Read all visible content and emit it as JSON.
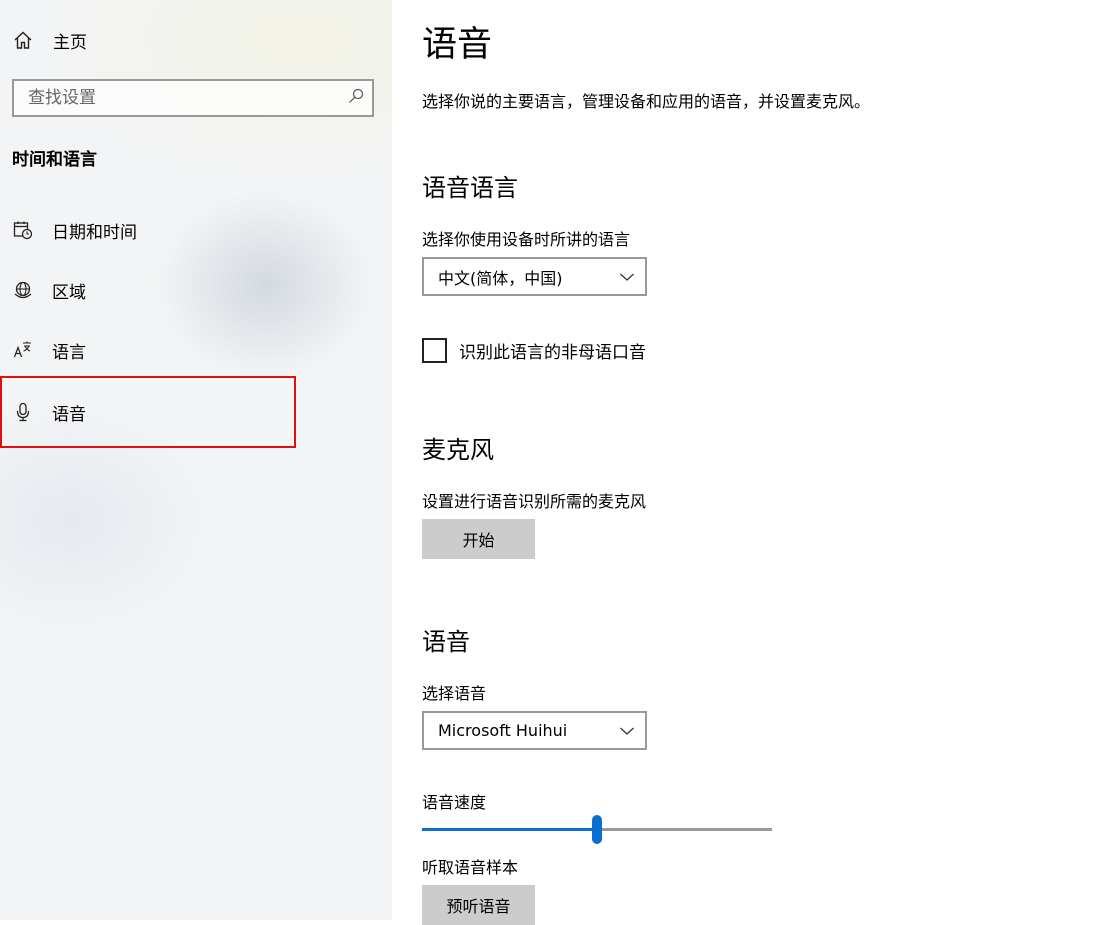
{
  "sidebar": {
    "home_label": "主页",
    "search_placeholder": "查找设置",
    "section_title": "时间和语言",
    "items": [
      {
        "label": "日期和时间",
        "icon": "calendar-clock-icon"
      },
      {
        "label": "区域",
        "icon": "globe-icon"
      },
      {
        "label": "语言",
        "icon": "language-icon"
      },
      {
        "label": "语音",
        "icon": "microphone-icon",
        "selected": true
      }
    ],
    "highlight_color": "#e01010"
  },
  "main": {
    "title": "语音",
    "description": "选择你说的主要语言，管理设备和应用的语音，并设置麦克风。",
    "speech_language": {
      "heading": "语音语言",
      "label": "选择你使用设备时所讲的语言",
      "selected": "中文(简体，中国)",
      "accent_checkbox_label": "识别此语言的非母语口音",
      "accent_checked": false
    },
    "microphone": {
      "heading": "麦克风",
      "label": "设置进行语音识别所需的麦克风",
      "button": "开始"
    },
    "voices": {
      "heading": "语音",
      "choose_label": "选择语音",
      "selected_voice": "Microsoft Huihui",
      "speed_label": "语音速度",
      "speed_fraction": 0.5,
      "preview_label": "听取语音样本",
      "preview_button": "预听语音"
    },
    "accent_color": "#0a6fd0"
  }
}
